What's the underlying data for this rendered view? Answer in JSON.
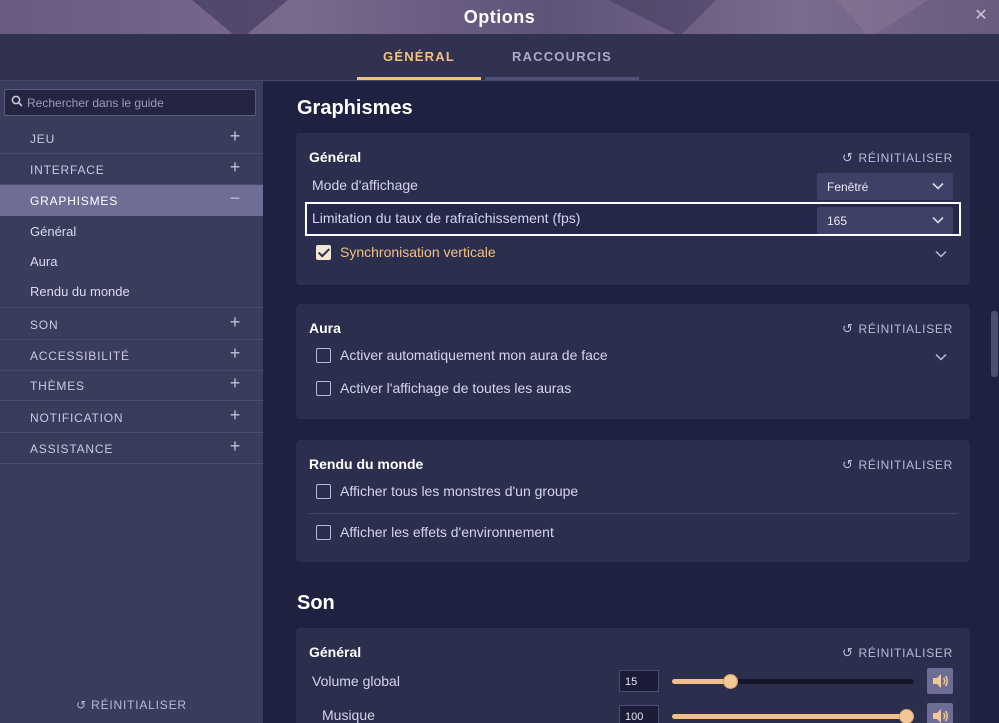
{
  "window": {
    "title": "Options",
    "close_icon": "close-icon"
  },
  "tabs": [
    {
      "label": "GÉNÉRAL",
      "active": true
    },
    {
      "label": "RACCOURCIS",
      "active": false
    }
  ],
  "colors": {
    "accent": "#f2c07f",
    "sidebar_active": "#6e6d96",
    "card_bg": "#2c2e4d",
    "page_bg": "#1f2140"
  },
  "sidebar": {
    "search_placeholder": "Rechercher dans le guide",
    "items": [
      {
        "label": "JEU",
        "toggle": "+"
      },
      {
        "label": "INTERFACE",
        "toggle": "+"
      },
      {
        "label": "GRAPHISMES",
        "toggle": "−",
        "active": true
      },
      {
        "label": "SON",
        "toggle": "+"
      },
      {
        "label": "ACCESSIBILITÉ",
        "toggle": "+"
      },
      {
        "label": "THÈMES",
        "toggle": "+"
      },
      {
        "label": "NOTIFICATION",
        "toggle": "+"
      },
      {
        "label": "ASSISTANCE",
        "toggle": "+"
      }
    ],
    "sub_items": [
      "Général",
      "Aura",
      "Rendu du monde"
    ],
    "reset_label": "RÉINITIALISER"
  },
  "main": {
    "sections": [
      {
        "title": "Graphismes",
        "cards": [
          {
            "title": "Général",
            "reset_label": "RÉINITIALISER",
            "display_mode_label": "Mode d'affichage",
            "display_mode_value": "Fenêtré",
            "fps_label": "Limitation du taux de rafraîchissement (fps)",
            "fps_value": "165",
            "vsync_label": "Synchronisation verticale",
            "vsync_checked": true
          },
          {
            "title": "Aura",
            "reset_label": "RÉINITIALISER",
            "options": [
              {
                "label": "Activer automatiquement mon aura de face",
                "checked": false
              },
              {
                "label": "Activer l'affichage de toutes les auras",
                "checked": false
              }
            ]
          },
          {
            "title": "Rendu du monde",
            "reset_label": "RÉINITIALISER",
            "options": [
              {
                "label": "Afficher tous les monstres d'un groupe",
                "checked": false
              },
              {
                "label": "Afficher les effets d'environnement",
                "checked": false
              }
            ]
          }
        ]
      },
      {
        "title": "Son",
        "cards": [
          {
            "title": "Général",
            "reset_label": "RÉINITIALISER",
            "volumes": [
              {
                "label": "Volume global",
                "value": "15",
                "level": 0.15
              },
              {
                "label": "Musique",
                "value": "100",
                "level": 1.0
              }
            ]
          }
        ]
      }
    ]
  }
}
